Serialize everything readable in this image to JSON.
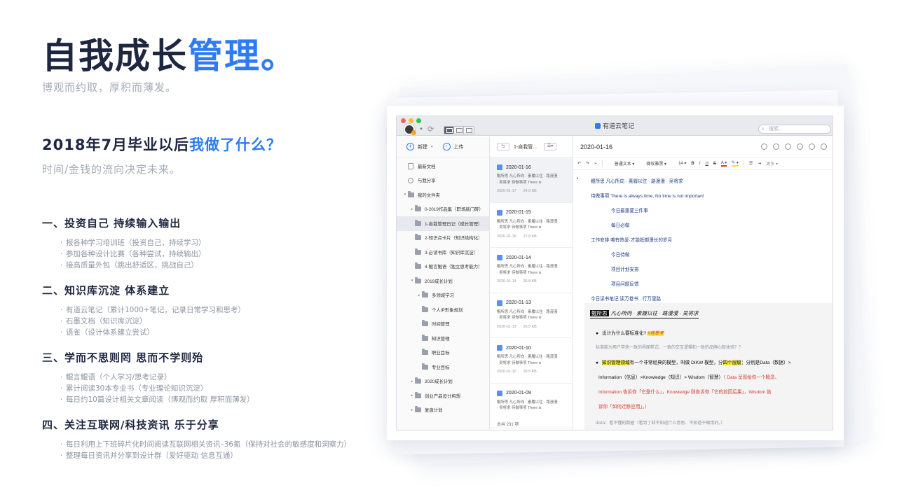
{
  "hero": {
    "title_main": "自我成长",
    "title_accent": "管理。",
    "subtitle": "博观而约取，厚积而薄发。"
  },
  "question": {
    "title_main": "2018年7月毕业以后",
    "title_accent": "我做了什么？",
    "subtitle": "时间/金钱的流向决定未来。"
  },
  "sections": [
    {
      "heading": "一、投资自己  持续输入输出",
      "items": [
        "报各种学习培训班（投资自己，持续学习）",
        "参加各种设计比赛（各种尝试，持续输出）",
        "接高质量外包（跳出舒适区，挑战自己）"
      ]
    },
    {
      "heading": "二、知识库沉淀  体系建立",
      "items": [
        "有道云笔记（累计1000+笔记，记录日常学习和思考）",
        "石墨文档（知识库沉淀）",
        "语雀（设计体系建立尝试）"
      ]
    },
    {
      "heading": "三、学而不思则罔  思而不学则殆",
      "items": [
        "鲲言鲲语（个人学习/思考记录）",
        "累计阅读30本专业书（专业理论知识沉淀）",
        "每日约10篇设计相关文章阅读（博观而约取 厚积而薄发）"
      ]
    },
    {
      "heading": "四、关注互联网/科技资讯  乐于分享",
      "items": [
        "每日利用上下班碎片化时间阅读互联网相关资讯–36氪（保持对社会的敏感度和洞察力）",
        "整理每日资讯并分享到设计群（爱好驱动 信息互通）"
      ]
    }
  ],
  "app": {
    "title": "有道云笔记",
    "search_placeholder": "搜索...",
    "colors": {
      "accent": "#2f7bf5",
      "traffic_red": "#ff5f57",
      "traffic_yellow": "#febc2e",
      "traffic_green": "#28c840"
    },
    "sidebar": {
      "new_label": "新建",
      "new_caret": "▾",
      "upload_label": "上传",
      "items": [
        {
          "label": "最新文档",
          "icon": "doc-icon",
          "arrow": "",
          "indent": 0
        },
        {
          "label": "与我分享",
          "icon": "share-icon",
          "arrow": "",
          "indent": 0
        },
        {
          "label": "我的文件夹",
          "icon": "folder-icon",
          "arrow": "▾",
          "indent": 0
        },
        {
          "label": "0-2019作品集（职场敲门砖）",
          "icon": "folder-icon",
          "arrow": "▸",
          "indent": 1
        },
        {
          "label": "1-自我管理日记（成长管理）",
          "icon": "folder-icon",
          "arrow": "",
          "indent": 1,
          "active": true
        },
        {
          "label": "2-知识点卡片（知识结构化）",
          "icon": "folder-icon",
          "arrow": "",
          "indent": 1
        },
        {
          "label": "3-必读书库（知识库沉淀）",
          "icon": "folder-icon",
          "arrow": "",
          "indent": 1
        },
        {
          "label": "4-鲲言鲲语（独立思考能力）",
          "icon": "folder-icon",
          "arrow": "",
          "indent": 1
        },
        {
          "label": "2019成长计划",
          "icon": "folder-icon",
          "arrow": "▾",
          "indent": 1
        },
        {
          "label": "多领域学习",
          "icon": "folder-icon",
          "arrow": "▸",
          "indent": 2
        },
        {
          "label": "个人IP形象规划",
          "icon": "folder-icon",
          "arrow": "",
          "indent": 2
        },
        {
          "label": "时间管理",
          "icon": "folder-icon",
          "arrow": "",
          "indent": 2
        },
        {
          "label": "知识管理",
          "icon": "folder-icon",
          "arrow": "",
          "indent": 2
        },
        {
          "label": "职业目标",
          "icon": "folder-icon",
          "arrow": "",
          "indent": 2
        },
        {
          "label": "专业目标",
          "icon": "folder-icon",
          "arrow": "",
          "indent": 2
        },
        {
          "label": "2020成长计划",
          "icon": "folder-icon",
          "arrow": "▸",
          "indent": 1
        },
        {
          "label": "创业产品设计构想",
          "icon": "folder-icon",
          "arrow": "▸",
          "indent": 1
        },
        {
          "label": "复盘计划",
          "icon": "folder-icon",
          "arrow": "▸",
          "indent": 1
        }
      ]
    },
    "notelist": {
      "back_label": "⮌",
      "folder_label": "1-自我管...",
      "sort_label": "☰▾",
      "notes": [
        {
          "title": "2020-01-16",
          "line1": "鲲所思 凡心所向 · 素履以往 · 路漫漫",
          "line2": "· 吴将求 待做事项 There is",
          "date": "2020-01-17",
          "size": "24.9 KB",
          "active": true
        },
        {
          "title": "2020-01-15",
          "line1": "鲲所思 凡心所向 · 素履以往 · 路漫漫",
          "line2": "· 吴将求 待做事项 There is",
          "date": "2020-01-16",
          "size": "27.8 KB"
        },
        {
          "title": "2020-01-14",
          "line1": "鲲所思 凡心所向 · 素履以往 · 路漫漫",
          "line2": "· 吴将求 待做事项 There is",
          "date": "2020-01-14",
          "size": "26.8 KB"
        },
        {
          "title": "2020-01-13",
          "line1": "鲲所思 凡心所向 · 素履以往 · 路漫漫",
          "line2": "· 吴将求 待做事项 There is",
          "date": "2020-01-13",
          "size": "26.5 KB"
        },
        {
          "title": "2020-01-10",
          "line1": "鲲所思 凡心所向 · 素履以往 · 路漫漫",
          "line2": "· 吴将求 待做事项 There is",
          "date": "2020-01-10",
          "size": "26.5 KB"
        },
        {
          "title": "2020-01-09",
          "line1": "鲲所思 凡心所向 · 素履以往 · 路漫漫",
          "line2": "· 吴将求 待做事项 There is",
          "date": "",
          "size": ""
        }
      ],
      "total": "总共 231 项"
    },
    "editor": {
      "title": "2020-01-16",
      "toolbar": {
        "undo": "↶",
        "redo": "↷",
        "format_brush": "⌁",
        "style": "普通文本 ▾",
        "font": "微软雅黑 ▾",
        "size": "14 ▾",
        "bold": "B",
        "italic": "I",
        "underline": "U",
        "strike": "S",
        "color": "A ▾",
        "highlight": "✎ ▾",
        "list": "☰",
        "indent": "⇥",
        "more": "更多 ▾"
      },
      "rows": [
        {
          "text": "鲲所思   凡心所向 · 素履以往 · 路漫漫 · 吴将求",
          "indent": 1,
          "bullet": "•"
        },
        {
          "text": "待做事项    There is always time, No time is not importan!",
          "indent": 1,
          "bullet": ""
        },
        {
          "text": "今日最重要三件事",
          "indent": 2,
          "bullet": ""
        },
        {
          "text": "每日必做",
          "indent": 2,
          "bullet": ""
        },
        {
          "text": "工作安排    唯有热爱·才能抵御漫长的岁月",
          "indent": 1,
          "bullet": ""
        },
        {
          "text": "今日待做",
          "indent": 2,
          "bullet": ""
        },
        {
          "text": "项目计划安排",
          "indent": 2,
          "bullet": ""
        },
        {
          "text": "项目问题反馈",
          "indent": 2,
          "bullet": ""
        },
        {
          "text": "今日读书笔记   读万卷书 · 行万里路",
          "indent": 1,
          "bullet": ""
        }
      ],
      "quote": {
        "tag": "鲲所思",
        "title": "凡心所向 · 素履以往 · 路漫漫 · 吴将求",
        "q1": "设计为什么要标准化?",
        "q1_mark": "#待思考",
        "gray1": "标准能为用户带来一致的界面样式、一致的交互逻辑和一致的品牌心智体验？？",
        "l1_hl": "知识管理领域",
        "l1_a": "有一个非常经典的模型，叫做 DIKW 模型，分",
        "l1_hl2": "四个层级",
        "l1_b": "：分别是Data（数据）>",
        "l2": "Information（信息）>Knowledge（知识）> Wisdom（智慧）",
        "l2_red": "（ Data 呈现给你一个概念、",
        "l3_red": "Information 告诉你「它是什么」，Knowledge 则告诉你「它的前因后果」，Wisdom 告",
        "l4_red": "诉你「如何迁移应用」。）",
        "gray2": "data：看不懂的数据（看到了却不知道什么意思、不知道干嘛用的。）"
      }
    }
  }
}
